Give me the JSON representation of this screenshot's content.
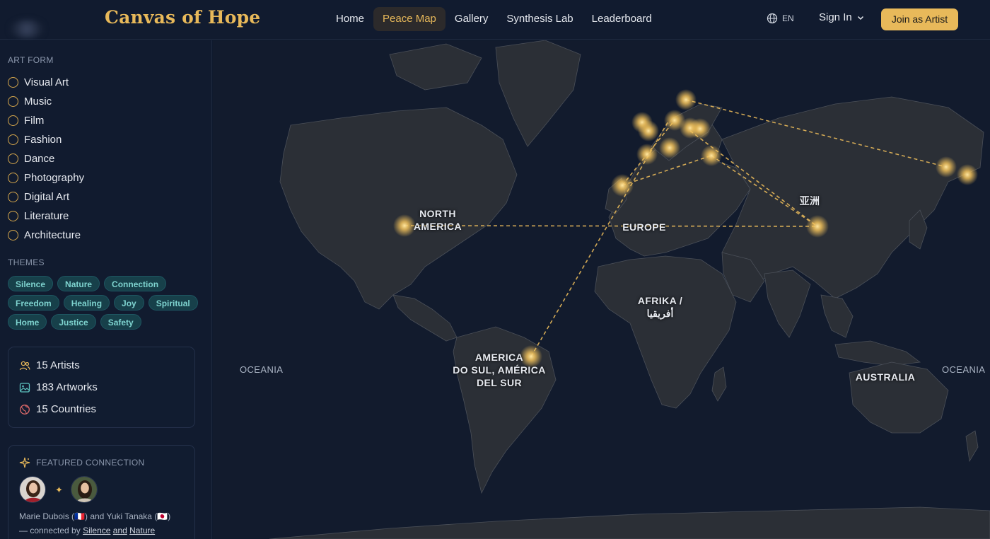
{
  "header": {
    "logo": "Canvas of Hope",
    "nav": [
      {
        "label": "Home",
        "active": false
      },
      {
        "label": "Peace Map",
        "active": true
      },
      {
        "label": "Gallery",
        "active": false
      },
      {
        "label": "Synthesis Lab",
        "active": false
      },
      {
        "label": "Leaderboard",
        "active": false
      }
    ],
    "lang": "EN",
    "sign_in": "Sign In",
    "join": "Join as Artist"
  },
  "sidebar": {
    "art_form_label": "ART FORM",
    "art_forms": [
      "Visual Art",
      "Music",
      "Film",
      "Fashion",
      "Dance",
      "Photography",
      "Digital Art",
      "Literature",
      "Architecture"
    ],
    "themes_label": "THEMES",
    "themes": [
      "Silence",
      "Nature",
      "Connection",
      "Freedom",
      "Healing",
      "Joy",
      "Spiritual",
      "Home",
      "Justice",
      "Safety"
    ],
    "stats": {
      "artists": "15 Artists",
      "artworks": "183 Artworks",
      "countries": "15 Countries"
    },
    "featured": {
      "title": "FEATURED CONNECTION",
      "artist_a": "Marie Dubois",
      "flag_a": "(🇫🇷)",
      "and": "and",
      "artist_b": "Yuki Tanaka",
      "flag_b": "(🇯🇵)",
      "connected_by": "— connected by",
      "theme_a": "Silence",
      "theme_b": "Nature"
    }
  },
  "map": {
    "labels": {
      "north_america": "NORTH\nAMERICA",
      "europe": "EUROPE",
      "asia": "亚洲",
      "africa": "AFRIKA /\nأفريقيا",
      "south_america": "AMERICA\nDO SUL, AMÉRICA\nDEL SUR",
      "australia": "AUSTRALIA",
      "oceania_left": "OCEANIA",
      "oceania_right": "OCEANIA"
    },
    "accent_color": "#e8b95a"
  }
}
